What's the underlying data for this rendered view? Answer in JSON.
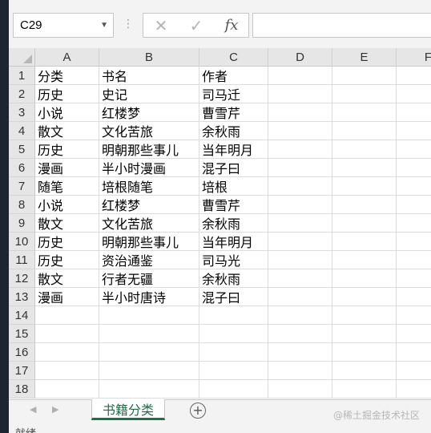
{
  "formula_bar": {
    "name_box": "C29",
    "cancel_icon": "✕",
    "enter_icon": "✓",
    "fx_label": "fx",
    "formula_value": ""
  },
  "columns": [
    "A",
    "B",
    "C",
    "D",
    "E",
    "F"
  ],
  "rows": [
    {
      "num": "1",
      "a": "分类",
      "b": "书名",
      "c": "作者"
    },
    {
      "num": "2",
      "a": "历史",
      "b": "史记",
      "c": "司马迁"
    },
    {
      "num": "3",
      "a": "小说",
      "b": "红楼梦",
      "c": "曹雪芹"
    },
    {
      "num": "4",
      "a": "散文",
      "b": "文化苦旅",
      "c": "余秋雨"
    },
    {
      "num": "5",
      "a": "历史",
      "b": "明朝那些事儿",
      "c": "当年明月"
    },
    {
      "num": "6",
      "a": "漫画",
      "b": "半小时漫画",
      "c": "混子曰"
    },
    {
      "num": "7",
      "a": "随笔",
      "b": "培根随笔",
      "c": "培根"
    },
    {
      "num": "8",
      "a": "小说",
      "b": "红楼梦",
      "c": "曹雪芹"
    },
    {
      "num": "9",
      "a": "散文",
      "b": "文化苦旅",
      "c": "余秋雨"
    },
    {
      "num": "10",
      "a": "历史",
      "b": "明朝那些事儿",
      "c": "当年明月"
    },
    {
      "num": "11",
      "a": "历史",
      "b": "资治通鉴",
      "c": "司马光"
    },
    {
      "num": "12",
      "a": "散文",
      "b": "行者无疆",
      "c": "余秋雨"
    },
    {
      "num": "13",
      "a": "漫画",
      "b": "半小时唐诗",
      "c": "混子曰"
    },
    {
      "num": "14",
      "a": "",
      "b": "",
      "c": ""
    },
    {
      "num": "15",
      "a": "",
      "b": "",
      "c": ""
    },
    {
      "num": "16",
      "a": "",
      "b": "",
      "c": ""
    },
    {
      "num": "17",
      "a": "",
      "b": "",
      "c": ""
    },
    {
      "num": "18",
      "a": "",
      "b": "",
      "c": ""
    }
  ],
  "sheet_tabs": {
    "active": "书籍分类",
    "add_icon": "+",
    "prev_icon": "◀",
    "next_icon": "▶"
  },
  "watermark": "@稀土掘金技术社区",
  "status": "就绪",
  "colors": {
    "accent": "#1e7145",
    "header_bg": "#e6e6e6",
    "gridline": "#dcdcdc"
  }
}
